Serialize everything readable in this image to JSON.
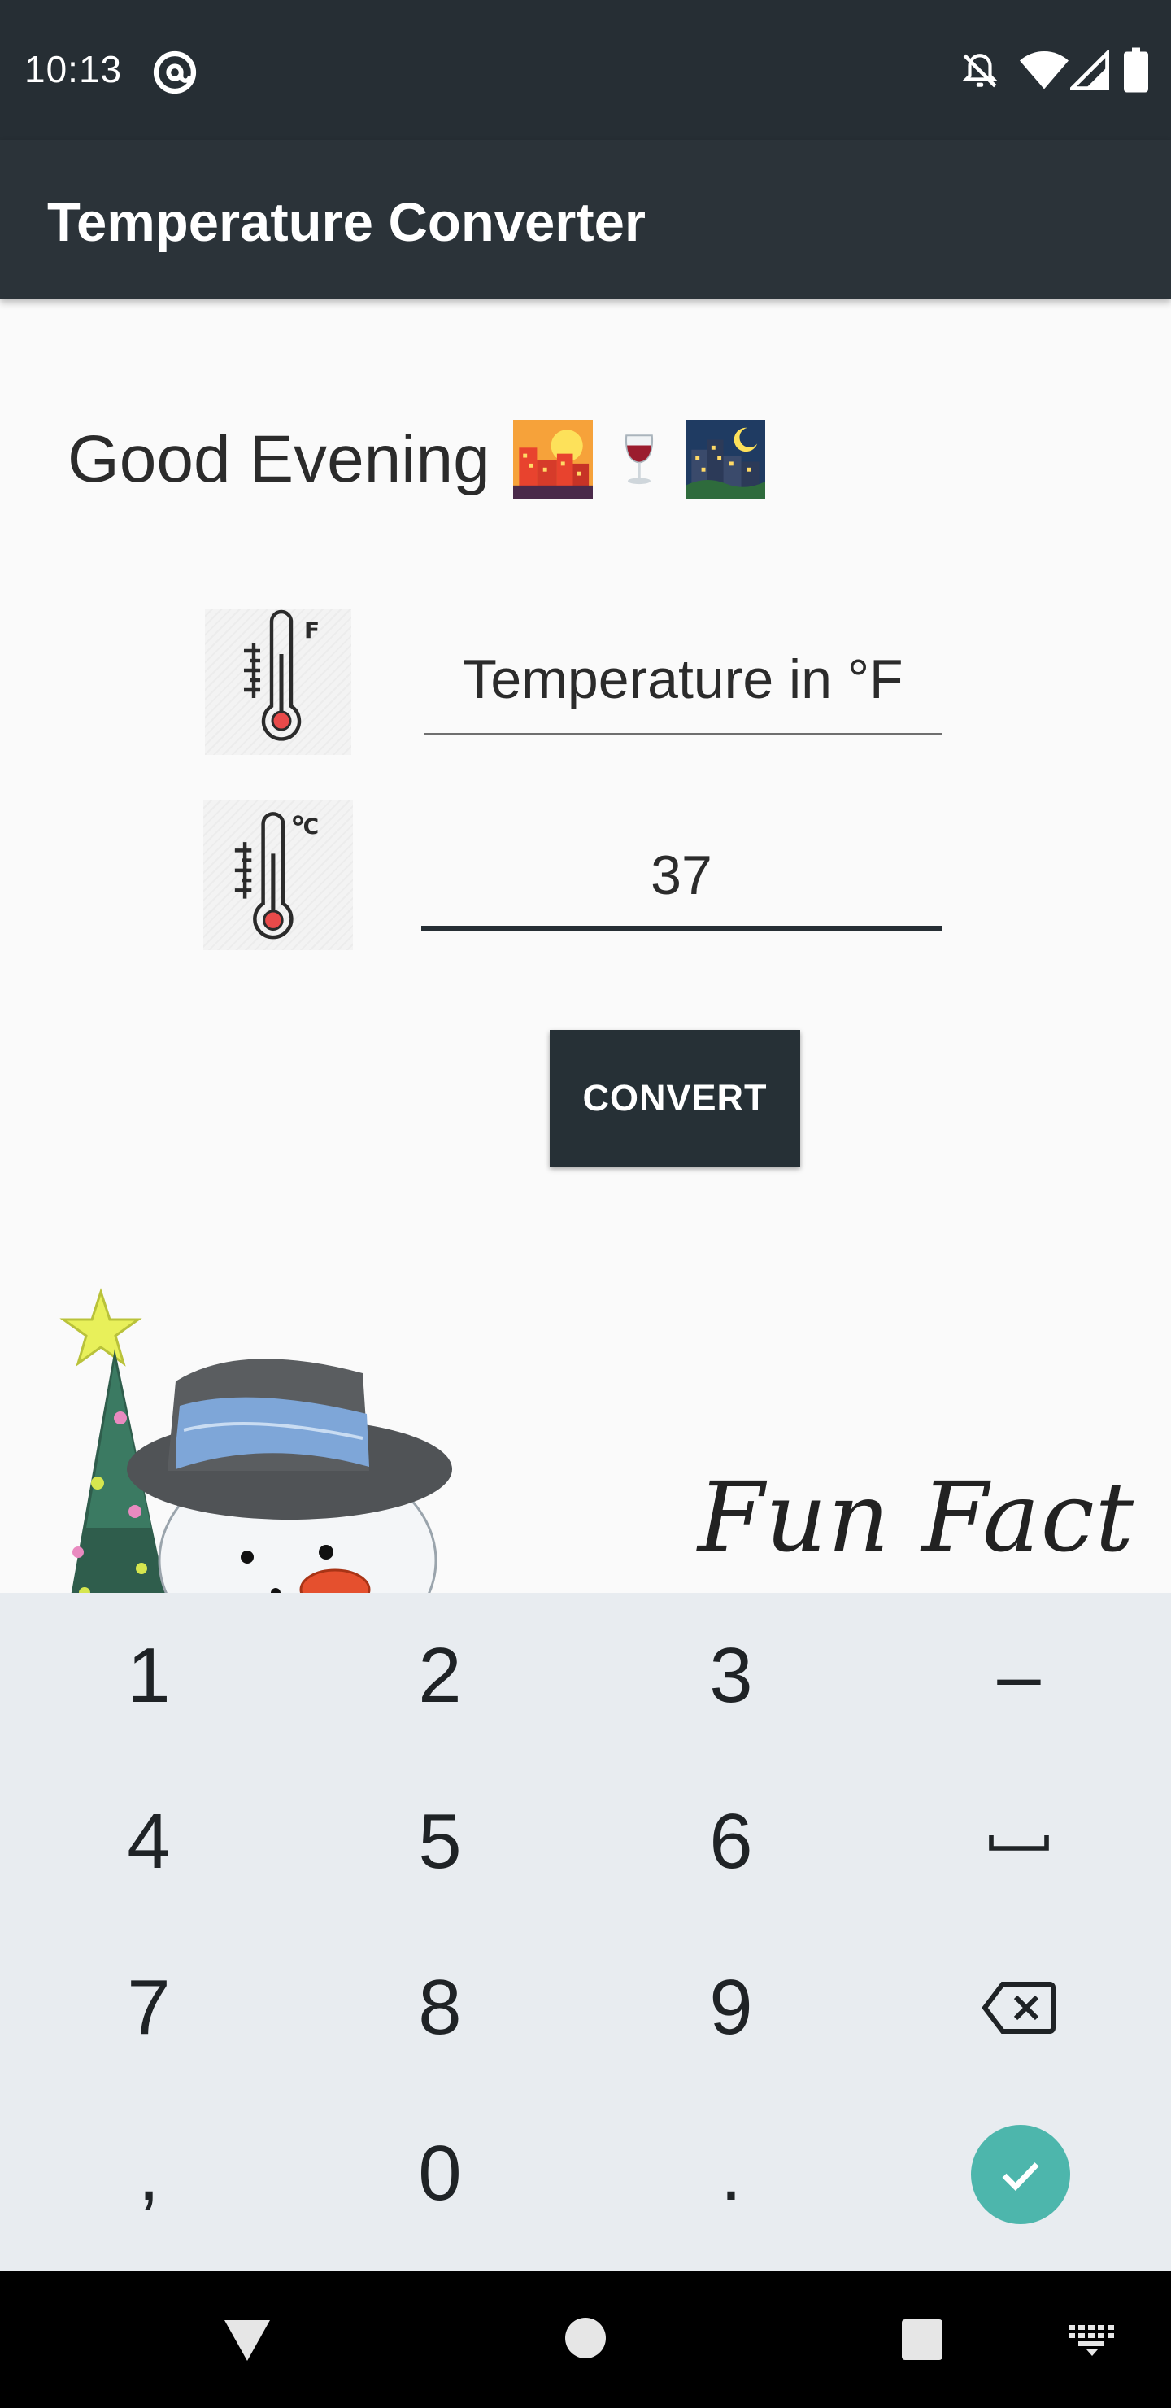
{
  "status_bar": {
    "time": "10:13",
    "icons": [
      "at-sign-icon",
      "notifications-off-icon",
      "wifi-icon",
      "cell-signal-icon",
      "battery-icon"
    ]
  },
  "app_bar": {
    "title": "Temperature Converter"
  },
  "main": {
    "greeting": "Good Evening",
    "greeting_emojis": [
      "city-dusk-emoji",
      "wine-glass-emoji",
      "night-city-emoji"
    ],
    "fahrenheit_icon": "thermometer-fahrenheit-icon",
    "celsius_icon": "thermometer-celsius-icon",
    "fahrenheit_placeholder": "Temperature in °F",
    "fahrenheit_value": "",
    "celsius_value": "37",
    "convert_label": "CONVERT",
    "fun_fact_label": "Fun Fact",
    "illustration": "snowman-with-christmas-tree"
  },
  "keyboard": {
    "keys": [
      "1",
      "2",
      "3",
      "–",
      "4",
      "5",
      "6",
      "space",
      "7",
      "8",
      "9",
      "backspace",
      ",",
      "0",
      ".",
      "done"
    ]
  },
  "nav_bar": {
    "icons": [
      "back-icon",
      "home-icon",
      "recents-icon",
      "keyboard-switch-icon"
    ]
  },
  "colors": {
    "status_bar": "#262e34",
    "app_bar": "#2b3339",
    "button": "#263036",
    "keyboard_bg": "#e8ecf0",
    "done_key": "#4db6ac"
  }
}
